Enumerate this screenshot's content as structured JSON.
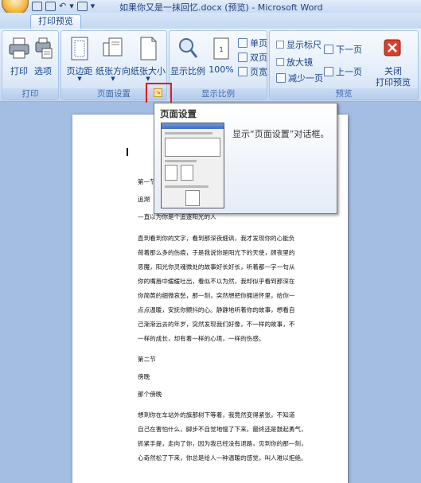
{
  "titlebar": {
    "title": "如果你又是一抹回忆.docx (预览) - Microsoft Word"
  },
  "tabs": [
    {
      "label": "打印预览",
      "active": true
    }
  ],
  "ribbon": {
    "groups": [
      {
        "label": "打印",
        "buttons": [
          "打印",
          "选项"
        ]
      },
      {
        "label": "页面设置",
        "buttons": [
          "页边距",
          "纸张方向",
          "纸张大小"
        ]
      },
      {
        "label": "显示比例",
        "buttons": [
          "显示比例",
          "100%"
        ],
        "small": [
          "单页",
          "双页",
          "页宽"
        ]
      },
      {
        "label": "预览",
        "checks": [
          "显示标尺",
          "放大镜"
        ],
        "small": [
          "减少一页",
          "下一页",
          "上一页"
        ]
      }
    ],
    "close": {
      "label": "关闭",
      "sublabel": "打印预览"
    }
  },
  "tooltip": {
    "title": "页面设置",
    "desc": "显示“页面设置”对话框。"
  },
  "document": {
    "lines": [
      "第一节",
      "追溯",
      "—直以为你是个追逐阳光的人",
      "直到看到你的文字，看到那深夜细讽，我才发现你的心能负",
      "荷着那么多的伤痕，于是我说你是阳光下的天使，顾夜里的",
      "恶魔，阳光你灵魂微处的故事好长好长，听着都一字一句从",
      "你的嘴唇中缓缓吐出，看似不以为然，我却似乎看到那深在",
      "你简黄的细微哀愁，那一刻，突然想把你拥进怀里，给你一",
      "点点温暖，安抚你颤抖的心。静静地听着你的故事，想看自",
      "己渐渐远去的年岁，突然发现我们好像，不一样的故事，不",
      "一样的成长，却有着一样的心境，一样的伤感。",
      "第二节",
      "傍晚",
      "那个傍晚",
      "想到你在车站外的旗那树下等着，我竟然变得紧张，不知道",
      "自己在害怕什么，脚步不自觉地慢了下来，最终还是鼓起勇气，",
      "抓紧手提，走向了你，因为我已经没有退路，见到你的那一刻，",
      "心奇然松了下来，你总是给人一种温暖的感觉，叫人难以拒绝。"
    ]
  }
}
